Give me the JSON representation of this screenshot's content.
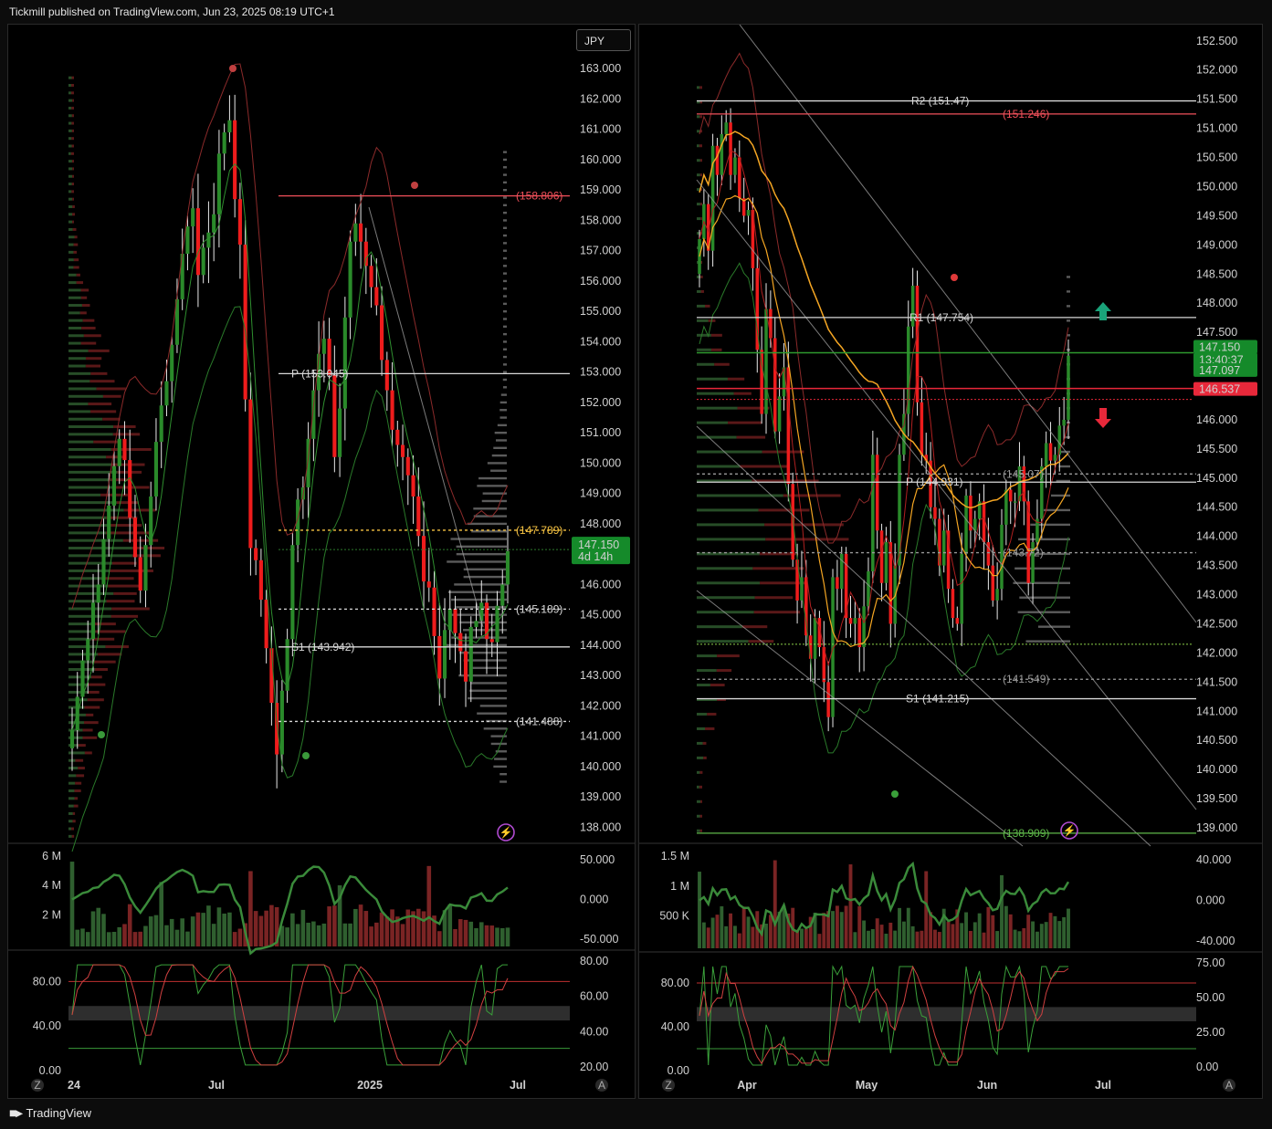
{
  "header": {
    "text": "Tickmill published on TradingView.com, Jun 23, 2025 08:19 UTC+1"
  },
  "footer": {
    "brand": "TradingView"
  },
  "colors": {
    "up": "#1f7a1f",
    "down": "#e01b1b",
    "red_line": "#f0505a",
    "green_line": "#8cd14a",
    "orange": "#f5a623",
    "badge_green": "#158a2a",
    "badge_red": "#e8283a"
  },
  "left": {
    "currency": "JPY",
    "price_ticks": [
      "163.000",
      "162.000",
      "161.000",
      "160.000",
      "159.000",
      "158.000",
      "157.000",
      "156.000",
      "155.000",
      "154.000",
      "153.000",
      "152.000",
      "151.000",
      "150.000",
      "149.000",
      "148.000",
      "147.000",
      "146.000",
      "145.000",
      "144.000",
      "143.000",
      "142.000",
      "141.000",
      "140.000",
      "139.000",
      "138.000"
    ],
    "price_range": [
      137.5,
      164.3
    ],
    "levels": [
      {
        "label": "(158.806)",
        "price": 158.806,
        "color": "#f0505a"
      },
      {
        "label": "P (153.045)",
        "price": 152.95,
        "color": "#d8d8d8"
      },
      {
        "label": "(147.789)",
        "price": 147.789,
        "color": "#f5c242"
      },
      {
        "label": "(145.189)",
        "price": 145.189,
        "color": "#d8d8d8"
      },
      {
        "label": "S1 (143.942)",
        "price": 143.942,
        "color": "#d8d8d8"
      },
      {
        "label": "(141.488)",
        "price": 141.488,
        "color": "#d8d8d8"
      }
    ],
    "last_price": {
      "value": "147.150",
      "countdown": "4d 14h"
    },
    "x_ticks": [
      "24",
      "Jul",
      "2025",
      "Jul"
    ],
    "volume_ticks": [
      "6 M",
      "4 M",
      "2 M"
    ],
    "osc_ticks": [
      "50.000",
      "0.000",
      "-50.000"
    ],
    "stoch_left_ticks": [
      "80.00",
      "40.00",
      "0.00"
    ],
    "stoch_right_ticks": [
      "80.00",
      "60.00",
      "40.00",
      "20.00"
    ]
  },
  "right": {
    "price_ticks": [
      "152.500",
      "152.000",
      "151.500",
      "151.000",
      "150.500",
      "150.000",
      "149.500",
      "149.000",
      "148.500",
      "148.000",
      "147.500",
      "147.000",
      "146.500",
      "146.000",
      "145.500",
      "145.000",
      "144.500",
      "144.000",
      "143.500",
      "143.000",
      "142.500",
      "142.000",
      "141.500",
      "141.000",
      "140.500",
      "140.000",
      "139.500",
      "139.000"
    ],
    "price_range": [
      138.75,
      152.7
    ],
    "levels": [
      {
        "label": "R2 (151.47)",
        "price": 151.47,
        "color": "#d8d8d8"
      },
      {
        "label": "(151.246)",
        "price": 151.246,
        "color": "#f0505a"
      },
      {
        "label": "R1 (147.754)",
        "price": 147.754,
        "color": "#d8d8d8"
      },
      {
        "label": "P (144.931)",
        "price": 144.931,
        "color": "#d8d8d8"
      },
      {
        "label": "(145.07)",
        "price": 145.07,
        "color": "#999999"
      },
      {
        "label": "(143.72)",
        "price": 143.72,
        "color": "#999999"
      },
      {
        "label": "(141.549)",
        "price": 141.549,
        "color": "#999999"
      },
      {
        "label": "S1 (141.215)",
        "price": 141.215,
        "color": "#d8d8d8"
      },
      {
        "label": "(138.909)",
        "price": 138.909,
        "color": "#5fb84a"
      }
    ],
    "price_badges": [
      {
        "value": "147.150",
        "color": "#158a2a"
      },
      {
        "value": "13:40:37",
        "color": "#158a2a"
      },
      {
        "value": "147.097",
        "color": "#158a2a"
      },
      {
        "value": "146.537",
        "color": "#e8283a"
      }
    ],
    "x_ticks": [
      "Apr",
      "May",
      "Jun",
      "Jul"
    ],
    "volume_ticks": [
      "1.5 M",
      "1 M",
      "500 K"
    ],
    "osc_ticks": [
      "40.000",
      "0.000",
      "-40.000"
    ],
    "stoch_left_ticks": [
      "80.00",
      "40.00",
      "0.00"
    ],
    "stoch_right_ticks": [
      "75.00",
      "50.00",
      "25.00",
      "0.00"
    ]
  },
  "chart_data": [
    {
      "type": "candlestick",
      "title": "",
      "currency": "JPY",
      "ylim": [
        137.5,
        164.3
      ],
      "x_ticks": [
        "24",
        "Jul",
        "2025",
        "Jul"
      ],
      "close": [
        141.2,
        142.3,
        143.5,
        144.2,
        145.4,
        146.0,
        147.5,
        148.6,
        149.9,
        150.8,
        150.1,
        148.2,
        146.9,
        145.8,
        147.3,
        148.9,
        150.7,
        151.9,
        152.7,
        153.9,
        155.4,
        156.9,
        157.8,
        158.4,
        156.2,
        157.1,
        157.6,
        158.2,
        160.2,
        160.9,
        161.3,
        158.7,
        157.2,
        152.1,
        147.2,
        146.8,
        145.5,
        143.9,
        142.1,
        140.4,
        142.5,
        144.2,
        147.3,
        148.8,
        149.2,
        150.8,
        152.4,
        153.6,
        154.1,
        152.9,
        150.2,
        151.8,
        154.8,
        157.3,
        157.9,
        157.3,
        156.5,
        155.8,
        155.2,
        153.4,
        152.4,
        151.1,
        150.6,
        150.2,
        149.6,
        148.9,
        147.6,
        146.1,
        145.9,
        144.3,
        142.9,
        144.5,
        145.2,
        144.4,
        143.8,
        142.8,
        144.6,
        144.8,
        145.4,
        144.2,
        144.1,
        145.3,
        146.0,
        147.1
      ]
    },
    {
      "type": "candlestick",
      "title": "",
      "ylim": [
        138.75,
        152.7
      ],
      "x_ticks": [
        "Apr",
        "May",
        "Jun",
        "Jul"
      ],
      "close": [
        149.1,
        149.7,
        148.9,
        150.7,
        150.2,
        150.9,
        151.1,
        150.2,
        150.5,
        149.8,
        149.5,
        149.6,
        148.6,
        147.2,
        146.1,
        147.9,
        147.4,
        145.8,
        146.4,
        146.9,
        144.9,
        143.6,
        142.9,
        143.3,
        142.3,
        141.9,
        142.6,
        142.1,
        141.5,
        140.9,
        143.3,
        143.1,
        143.7,
        142.6,
        142.5,
        142.6,
        142.1,
        142.8,
        143.4,
        145.4,
        144.1,
        143.2,
        143.9,
        142.5,
        143.5,
        145.4,
        146.1,
        147.6,
        148.3,
        146.3,
        145.4,
        145.3,
        144.5,
        144.3,
        143.5,
        144.1,
        143.1,
        142.6,
        142.5,
        143.7,
        144.7,
        144.1,
        144.3,
        144.6,
        143.9,
        143.5,
        142.9,
        143.1,
        144.2,
        144.8,
        144.6,
        144.6,
        145.2,
        144.6,
        143.2,
        143.9,
        144.3,
        145.2,
        145.6,
        145.3,
        145.4,
        145.9,
        146.0,
        147.1
      ]
    }
  ]
}
